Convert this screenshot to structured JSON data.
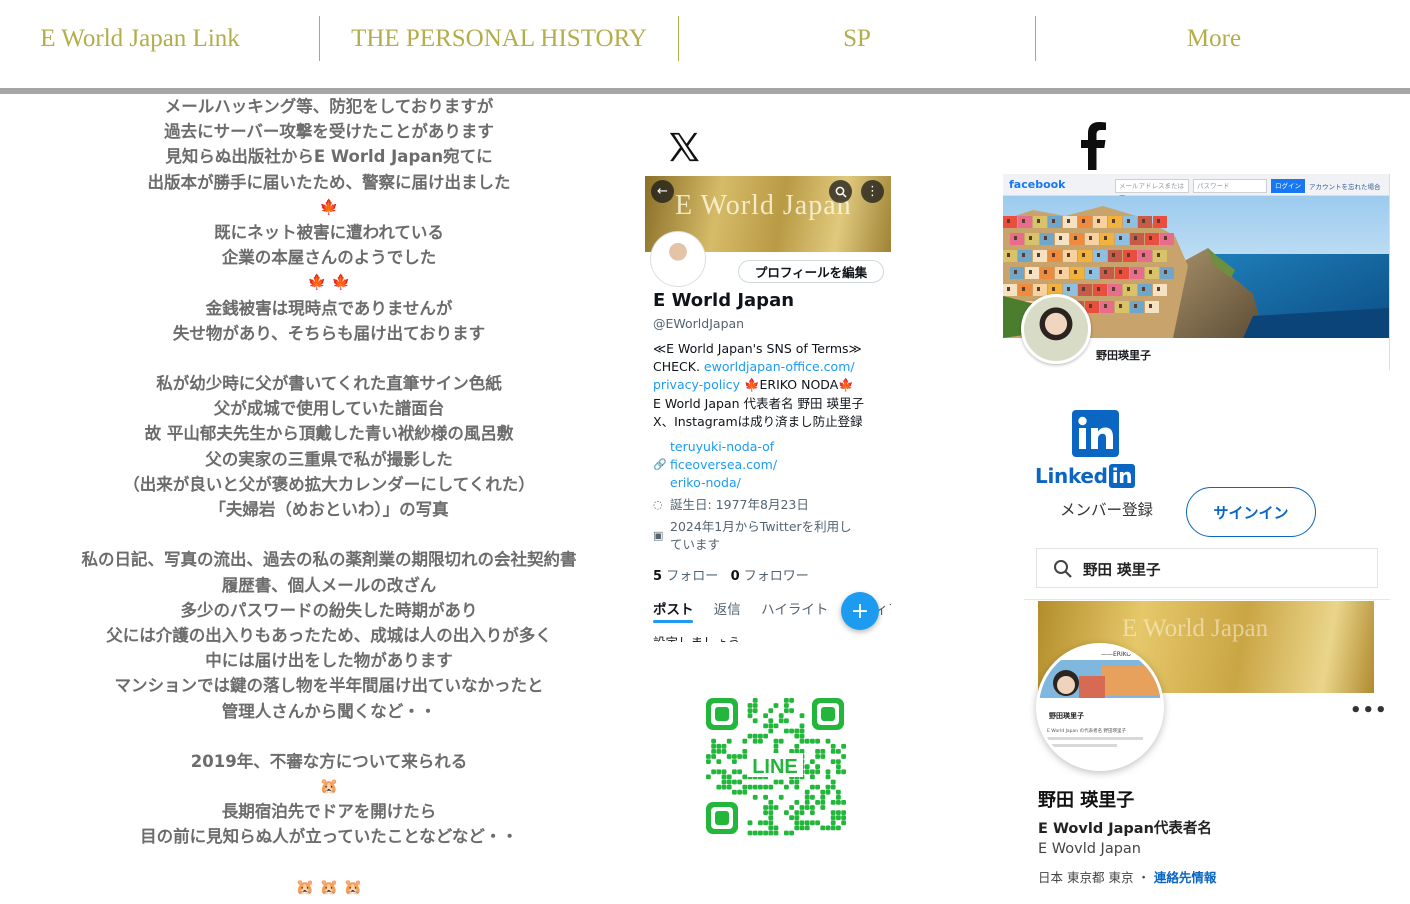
{
  "nav": {
    "items": [
      {
        "label": "E World Japan Link"
      },
      {
        "label": "THE PERSONAL HISTORY"
      },
      {
        "label": "SP"
      },
      {
        "label": "More"
      }
    ],
    "color": "#b3ad4a",
    "rule_color": "#a6a6a6"
  },
  "story": {
    "lines": [
      "メールハッキング等、防犯をしておりますが",
      "過去にサーバー攻撃を受けたことがあります",
      "見知らぬ出版社からE World Japan宛てに",
      "出版本が勝手に届いたため、警察に届け出ました",
      "🍁",
      "既にネット被害に遭われている",
      "企業の本屋さんのようでした",
      "🍁 🍁",
      "金銭被害は現時点でありませんが",
      "失せ物があり、そちらも届け出ております",
      "",
      "私が幼少時に父が書いてくれた直筆サイン色紙",
      "父が成城で使用していた譜面台",
      "故 平山郁夫先生から頂戴した青い袱紗様の風呂敷",
      "父の実家の三重県で私が撮影した",
      "（出来が良いと父が褒め拡大カレンダーにしてくれた）",
      "「夫婦岩（めおといわ）」の写真",
      "",
      "私の日記、写真の流出、過去の私の薬剤業の期限切れの会社契約書",
      "履歴書、個人メールの改ざん",
      "多少のパスワードの紛失した時期があり",
      "父には介護の出入りもあったため、成城は人の出入りが多く",
      "中には届け出をした物があります",
      "マンションでは鍵の落し物を半年間届け出ていなかったと",
      "管理人さんから聞くなど・・",
      "",
      "2019年、不審な方について来られる",
      "🐹",
      "長期宿泊先でドアを開けたら",
      "目の前に見知らぬ人が立っていたことなどなど・・",
      "",
      "🐹 🐹 🐹"
    ]
  },
  "x_profile": {
    "logo_icon": "x-logo-icon",
    "banner_text": "E World Japan",
    "edit_profile": "プロフィールを編集",
    "name": "E World Japan",
    "handle": "@EWorldJapan",
    "bio": {
      "line1": "≪E World Japan's SNS of Terms≫",
      "line2_prefix": "CHECK. ",
      "line2_link": "eworldjapan-office.com/",
      "line3_link": "privacy-policy",
      "line3_rest": " 🍁ERIKO NODA🍁",
      "line4": "E World Japan 代表者名 野田 瑛里子",
      "line5": "X、Instagramは成り済まし防止登録"
    },
    "url_lines": [
      "teruyuki-noda-of",
      "ficeoversea.com/",
      "eriko-noda/"
    ],
    "birthday": "誕生日: 1977年8月23日",
    "joined_line1": "2024年1月からTwitterを利用し",
    "joined_line2": "ています",
    "following_count": "5",
    "following_label": "フォロー",
    "followers_count": "0",
    "followers_label": "フォロワー",
    "tabs": [
      "ポスト",
      "返信",
      "ハイライト",
      "メディア"
    ],
    "cut_text": "設定しましょう",
    "accent": "#1d9bf0"
  },
  "line_qr": {
    "label": "LINE",
    "color": "#22b73a"
  },
  "facebook": {
    "logo_icon": "facebook-f-icon",
    "brand": "facebook",
    "email_placeholder": "メールアドレスまたは電",
    "password_placeholder": "パスワード",
    "login": "ログイン",
    "forgot": "アカウントを忘れた場合",
    "name": "野田瑛里子",
    "brand_color": "#1877f2"
  },
  "linkedin": {
    "wordmark": "Linked",
    "wordmark_box": "in",
    "join": "メンバー登録",
    "sign_in": "サインイン",
    "search_value": "野田 瑛里子",
    "cover_text": "E World Japan",
    "avatar_header": "——ERIKO NODA",
    "avatar_name": "野田瑛里子",
    "avatar_bio": "E World Japan の代表者名 野田瑛里子",
    "name": "野田 瑛里子",
    "headline": "E Wovld Japan代表者名",
    "company": "E Wovld Japan",
    "location": "日本 東京都 東京 ・ ",
    "contact": "連絡先情報",
    "brand_color": "#0a66c2"
  }
}
